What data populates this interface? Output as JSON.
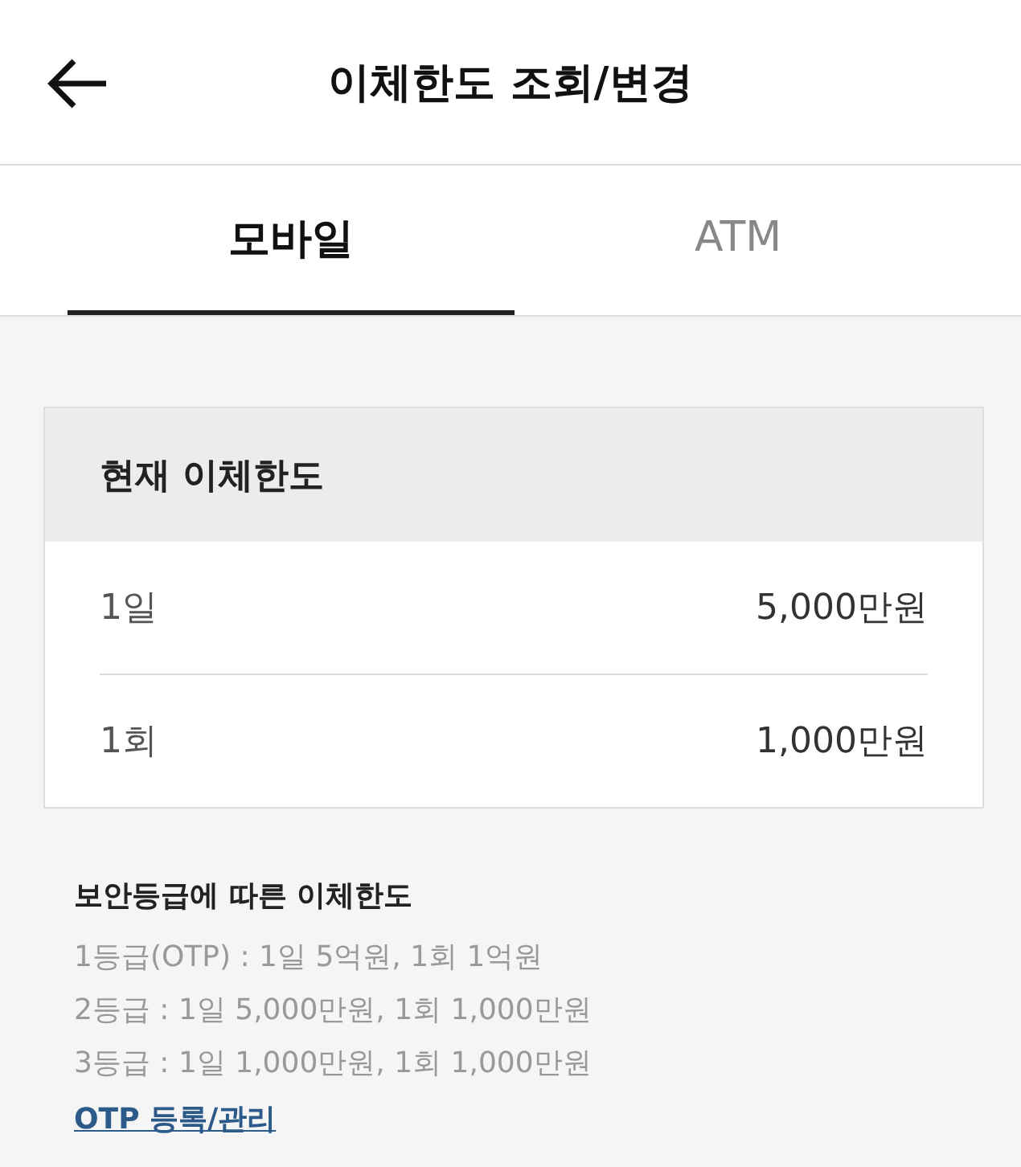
{
  "header": {
    "title": "이체한도 조회/변경"
  },
  "tabs": [
    {
      "label": "모바일",
      "selected": true
    },
    {
      "label": "ATM",
      "selected": false
    }
  ],
  "limit_card": {
    "title": "현재 이체한도",
    "rows": [
      {
        "label": "1일",
        "value": "5,000만원"
      },
      {
        "label": "1회",
        "value": "1,000만원"
      }
    ]
  },
  "security_info": {
    "title": "보안등급에 따른 이체한도",
    "lines": [
      "1등급(OTP) : 1일 5억원, 1회 1억원",
      "2등급 : 1일 5,000만원, 1회 1,000만원",
      "3등급 : 1일 1,000만원, 1회 1,000만원"
    ],
    "link": "OTP 등록/관리"
  }
}
